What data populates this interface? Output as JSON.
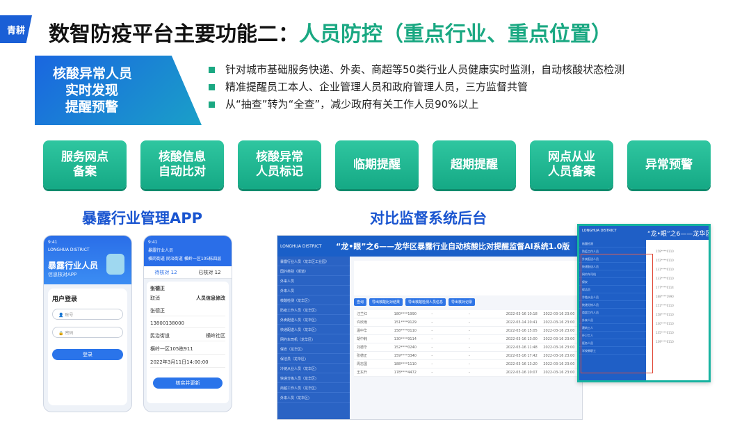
{
  "logo_text": "青耕",
  "title": {
    "prefix": "数智防疫平台主要功能二：",
    "highlight": "人员防控（重点行业、重点位置）"
  },
  "hero": {
    "lines": [
      "核酸异常人员",
      "实时发现",
      "提醒预警"
    ],
    "bullets": [
      "针对城市基础服务快递、外卖、商超等50类行业人员健康实时监测，自动核酸状态检测",
      "精准提醒员工本人、企业管理人员和政府管理人员，三方监督共管",
      "从“抽查”转为“全查”，减少政府有关工作人员90%以上"
    ]
  },
  "features": [
    {
      "line1": "服务网点",
      "line2": "备案"
    },
    {
      "line1": "核酸信息",
      "line2": "自动比对"
    },
    {
      "line1": "核酸异常",
      "line2": "人员标记"
    },
    {
      "line1": "临期提醒",
      "line2": ""
    },
    {
      "line1": "超期提醒",
      "line2": ""
    },
    {
      "line1": "网点从业",
      "line2": "人员备案"
    },
    {
      "line1": "异常预警",
      "line2": ""
    }
  ],
  "sections": {
    "app": "暴露行业管理APP",
    "backend": "对比监督系统后台"
  },
  "phone1": {
    "time": "9:41",
    "district": "LONGHUA DISTRICT",
    "title": "暴露行业人员",
    "subtitle": "信息核对APP",
    "login_heading": "用户登录",
    "account_placeholder": "账号",
    "password_placeholder": "密码",
    "login_button": "登录"
  },
  "phone2": {
    "time": "9:41",
    "header": "暴露行业人员",
    "address": "横岗街道 民治街道 横岭一区105栋四层",
    "tab_pending": "待核对 12",
    "tab_done": "已核对 12",
    "person": "张德正",
    "dialog_title": "人员信息修改",
    "cancel": "取消",
    "name": "张德正",
    "phone": "13800138000",
    "street": "民治街道",
    "community": "横岭社区",
    "addr": "横岭一区105栋911",
    "date": "2022年3月11日14:00:00",
    "submit": "核实并更新"
  },
  "backend": {
    "brand": "LONGHUA DISTRICT",
    "system_title": "“龙•眼”之6——龙华区暴露行业自动核酸比对提醒监督AI系统1.0版",
    "side_items": [
      "暴露行业人员（龙华区工业园）",
      "国外类别（街道）",
      "  外来人员",
      "  外来人员",
      "核酸检测（龙华区)",
      "防疫工作人员（龙华区)",
      "外卖配送人员（龙华区)",
      "快递配送人员（龙华区)",
      "网约车司机（龙华区)",
      "保安（龙华区)",
      "保洁员（龙华区)",
      "冷链从业人员（龙华区)",
      "快递分拣人员（龙华区)",
      "商超工作人员（龙华区)",
      "外来人员（龙华区)"
    ],
    "buttons": [
      "查询",
      "导出核酸比对结果",
      "导出核酸检测人员信息",
      "导出核对记录"
    ],
    "rows": [
      [
        "汪兰红",
        "180****1990",
        "-",
        "-",
        "2022-03-16 10:18",
        "2022-03-16 23:00"
      ],
      [
        "许欣雨",
        "151****9129",
        "-",
        "-",
        "2022-03-14 20:41",
        "2022-03-16 23:00"
      ],
      [
        "温中华",
        "158****0110",
        "-",
        "-",
        "2022-03-16 15:05",
        "2022-03-16 23:00"
      ],
      [
        "胡中韩",
        "130****9114",
        "-",
        "-",
        "2022-03-16 13:00",
        "2022-03-16 23:00"
      ],
      [
        "刘德华",
        "152****0240",
        "-",
        "-",
        "2022-03-16 11:48",
        "2022-03-16 23:00"
      ],
      [
        "张德正",
        "159****3340",
        "-",
        "-",
        "2022-03-16 17:42",
        "2022-03-16 23:00"
      ],
      [
        "周志国",
        "188****1110",
        "-",
        "-",
        "2022-03-16 13:20",
        "2022-03-16 23:00"
      ],
      [
        "王东升",
        "178****4472",
        "-",
        "-",
        "2022-03-16 10:07",
        "2022-03-16 23:00"
      ]
    ]
  },
  "popup": {
    "title": "“龙•眼”之6——龙华区",
    "side_items": [
      "核酸检测",
      "防疫工作人员",
      "外卖配送人员",
      "快递配送人员",
      "网约车司机",
      "保安",
      "保洁员",
      "冷链从业人员",
      "快递分拣人员",
      "商超工作人员",
      "外来人员",
      "建筑工人",
      "环卫工人",
      "医务人员",
      "学校教职工"
    ],
    "rows": [
      "158****0110",
      "152****0110",
      "131****0110",
      "133****0110",
      "177****0114",
      "188****1990",
      "151****0110",
      "158****0110",
      "130****0110",
      "135****0110",
      "139****0110"
    ]
  }
}
